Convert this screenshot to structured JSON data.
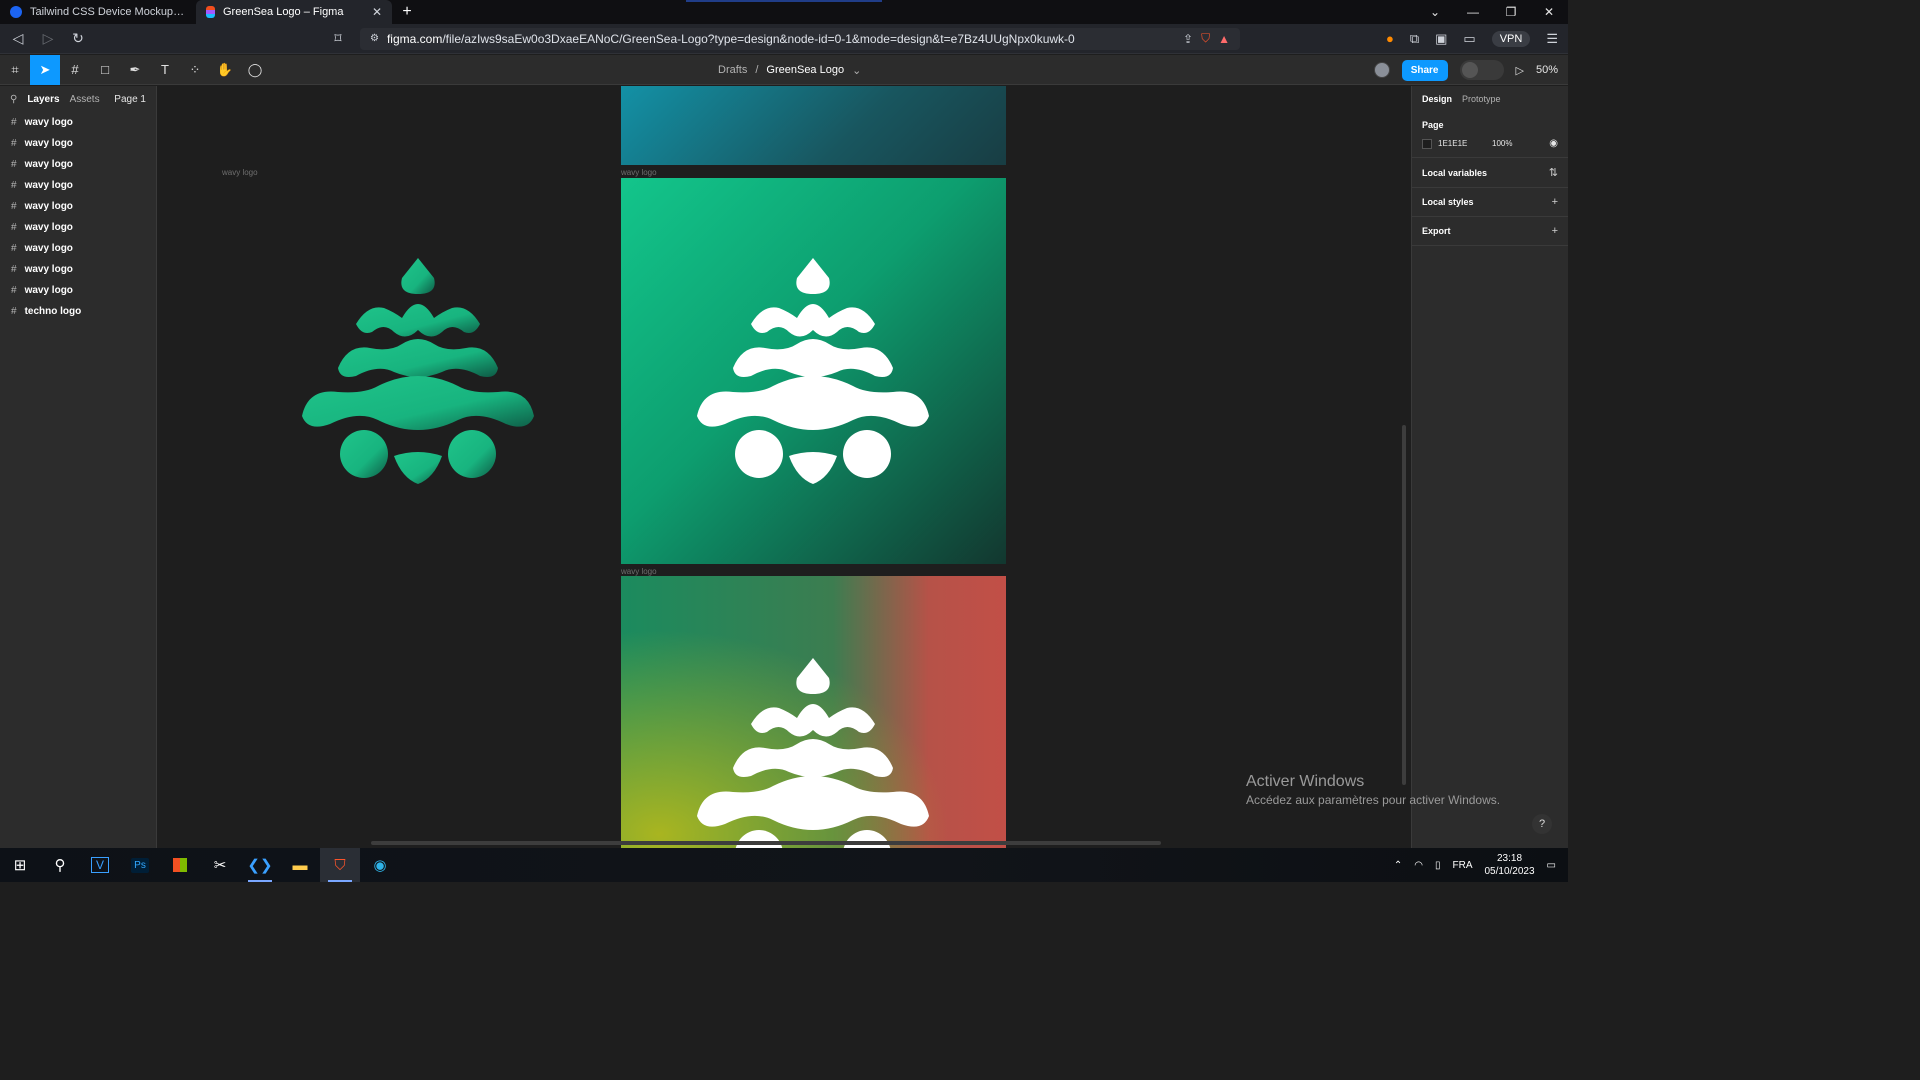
{
  "browser": {
    "tabs": [
      {
        "label": "Tailwind CSS Device Mockups - Flowbite",
        "active": false
      },
      {
        "label": "GreenSea Logo – Figma",
        "active": true
      }
    ],
    "url_host": "figma.com",
    "url_path": "/file/azIws9saEw0o3DxaeEANoC/GreenSea-Logo?type=design&node-id=0-1&mode=design&t=e7Bz4UUgNpx0kuwk-0",
    "vpn_label": "VPN"
  },
  "figma": {
    "breadcrumb_root": "Drafts",
    "file_name": "GreenSea Logo",
    "share_label": "Share",
    "zoom": "50%",
    "left_panel": {
      "tab_layers": "Layers",
      "tab_assets": "Assets",
      "page": "Page 1",
      "layers": [
        "wavy logo",
        "wavy logo",
        "wavy logo",
        "wavy logo",
        "wavy logo",
        "wavy logo",
        "wavy logo",
        "wavy logo",
        "wavy logo",
        "techno logo"
      ]
    },
    "canvas": {
      "frame_label_left": "wavy logo",
      "frame_label_mid": "wavy logo",
      "frame_label_bottom": "wavy logo"
    },
    "right_panel": {
      "tab_design": "Design",
      "tab_prototype": "Prototype",
      "page_title": "Page",
      "page_color": "1E1E1E",
      "page_opacity": "100%",
      "local_variables": "Local variables",
      "local_styles": "Local styles",
      "export": "Export"
    }
  },
  "windows": {
    "activation_title": "Activer Windows",
    "activation_sub": "Accédez aux paramètres pour activer Windows.",
    "lang": "FRA",
    "time": "23:18",
    "date": "05/10/2023"
  },
  "colors": {
    "accent": "#0d99ff",
    "logo_green": "#1fc48a",
    "canvas_bg": "#1e1e1e"
  }
}
